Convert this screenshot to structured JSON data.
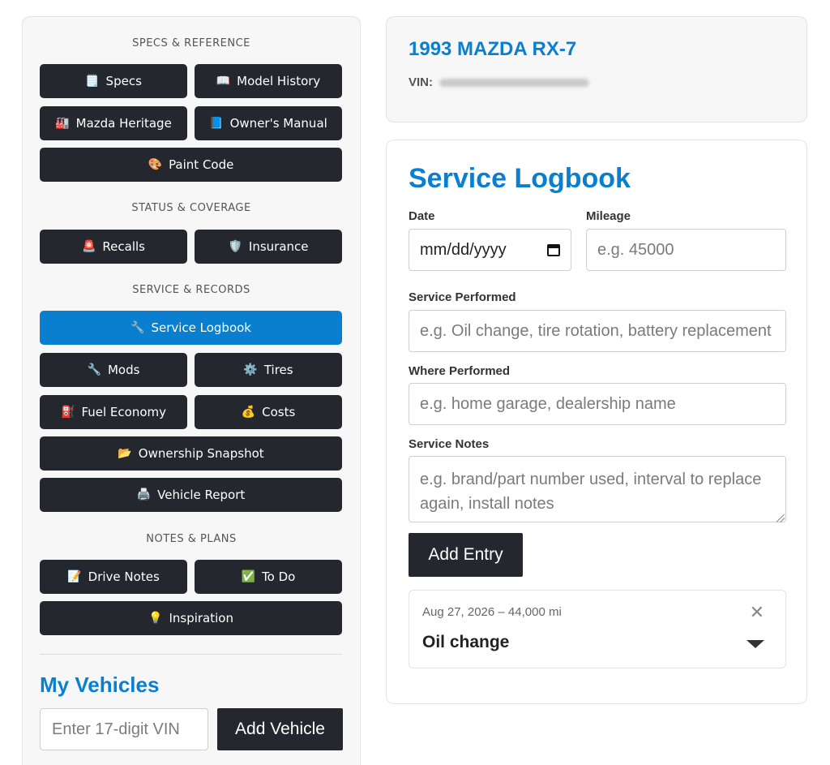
{
  "sidebar": {
    "sections": {
      "specs": "SPECS & REFERENCE",
      "status": "STATUS & COVERAGE",
      "service": "SERVICE & RECORDS",
      "notes": "NOTES & PLANS"
    },
    "buttons": {
      "specs": {
        "label": "Specs",
        "icon": "🗒️"
      },
      "model_history": {
        "label": "Model History",
        "icon": "📖"
      },
      "mazda_heritage": {
        "label": "Mazda Heritage",
        "icon": "🏭"
      },
      "owners_manual": {
        "label": "Owner's Manual",
        "icon": "📘"
      },
      "paint_code": {
        "label": "Paint Code",
        "icon": "🎨"
      },
      "recalls": {
        "label": "Recalls",
        "icon": "🚨"
      },
      "insurance": {
        "label": "Insurance",
        "icon": "🛡️"
      },
      "service_logbook": {
        "label": "Service Logbook",
        "icon": "🔧"
      },
      "mods": {
        "label": "Mods",
        "icon": "🔧"
      },
      "tires": {
        "label": "Tires",
        "icon": "⚙️"
      },
      "fuel_economy": {
        "label": "Fuel Economy",
        "icon": "⛽"
      },
      "costs": {
        "label": "Costs",
        "icon": "💰"
      },
      "ownership_snapshot": {
        "label": "Ownership Snapshot",
        "icon": "📂"
      },
      "vehicle_report": {
        "label": "Vehicle Report",
        "icon": "🖨️"
      },
      "drive_notes": {
        "label": "Drive Notes",
        "icon": "📝"
      },
      "to_do": {
        "label": "To Do",
        "icon": "✅"
      },
      "inspiration": {
        "label": "Inspiration",
        "icon": "💡"
      }
    },
    "my_vehicles": {
      "title": "My Vehicles",
      "vin_placeholder": "Enter 17-digit VIN",
      "add_label": "Add Vehicle"
    }
  },
  "vehicle": {
    "name": "1993 MAZDA RX-7",
    "vin_label": "VIN:"
  },
  "logbook": {
    "title": "Service Logbook",
    "date_label": "Date",
    "date_value": "mm/dd/yyyy",
    "mileage_label": "Mileage",
    "mileage_placeholder": "e.g. 45000",
    "service_label": "Service Performed",
    "service_placeholder": "e.g. Oil change, tire rotation, battery replacement",
    "where_label": "Where Performed",
    "where_placeholder": "e.g. home garage, dealership name",
    "notes_label": "Service Notes",
    "notes_placeholder": "e.g. brand/part number used, interval to replace again, install notes",
    "add_label": "Add Entry",
    "entries": [
      {
        "meta": "Aug 27, 2026 – 44,000 mi",
        "service": "Oil change",
        "close": "✕"
      }
    ]
  },
  "colors": {
    "accent": "#0a7fd0",
    "button_dark": "#24272d"
  }
}
